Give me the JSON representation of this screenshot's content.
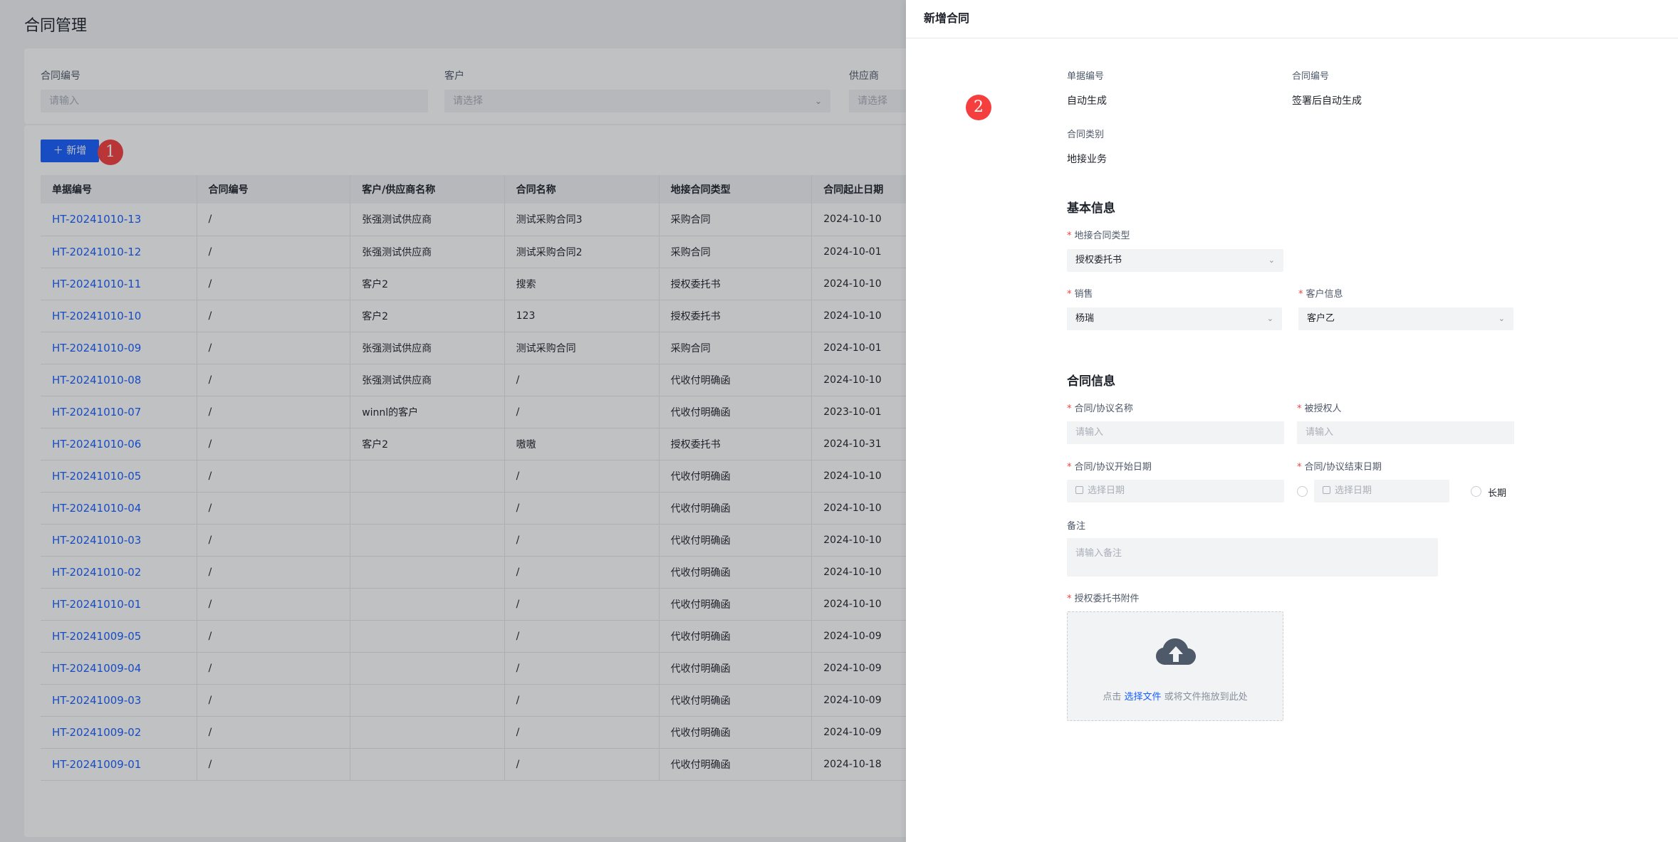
{
  "page": {
    "title": "合同管理",
    "filters": [
      {
        "label": "合同编号",
        "placeholder": "请输入"
      },
      {
        "label": "客户",
        "placeholder": "请选择"
      },
      {
        "label": "供应商",
        "placeholder": "请选择"
      }
    ],
    "add_button": "＋ 新增",
    "badge1": "1",
    "table": {
      "headers": [
        "单据编号",
        "合同编号",
        "客户/供应商名称",
        "合同名称",
        "地接合同类型",
        "合同起止日期"
      ],
      "rows": [
        [
          "HT-20241010-13",
          "/",
          "张强测试供应商",
          "测试采购合同3",
          "采购合同",
          "2024-10-10"
        ],
        [
          "HT-20241010-12",
          "/",
          "张强测试供应商",
          "测试采购合同2",
          "采购合同",
          "2024-10-01"
        ],
        [
          "HT-20241010-11",
          "/",
          "客户2",
          "搜索",
          "授权委托书",
          "2024-10-10"
        ],
        [
          "HT-20241010-10",
          "/",
          "客户2",
          "123",
          "授权委托书",
          "2024-10-10"
        ],
        [
          "HT-20241010-09",
          "/",
          "张强测试供应商",
          "测试采购合同",
          "采购合同",
          "2024-10-01"
        ],
        [
          "HT-20241010-08",
          "/",
          "张强测试供应商",
          "/",
          "代收付明确函",
          "2024-10-10"
        ],
        [
          "HT-20241010-07",
          "/",
          "winnl的客户",
          "/",
          "代收付明确函",
          "2023-10-01"
        ],
        [
          "HT-20241010-06",
          "/",
          "客户2",
          "嗷嗷",
          "授权委托书",
          "2024-10-31"
        ],
        [
          "HT-20241010-05",
          "/",
          "",
          "/",
          "代收付明确函",
          "2024-10-10"
        ],
        [
          "HT-20241010-04",
          "/",
          "",
          "/",
          "代收付明确函",
          "2024-10-10"
        ],
        [
          "HT-20241010-03",
          "/",
          "",
          "/",
          "代收付明确函",
          "2024-10-10"
        ],
        [
          "HT-20241010-02",
          "/",
          "",
          "/",
          "代收付明确函",
          "2024-10-10"
        ],
        [
          "HT-20241010-01",
          "/",
          "",
          "/",
          "代收付明确函",
          "2024-10-10"
        ],
        [
          "HT-20241009-05",
          "/",
          "",
          "/",
          "代收付明确函",
          "2024-10-09"
        ],
        [
          "HT-20241009-04",
          "/",
          "",
          "/",
          "代收付明确函",
          "2024-10-09"
        ],
        [
          "HT-20241009-03",
          "/",
          "",
          "/",
          "代收付明确函",
          "2024-10-09"
        ],
        [
          "HT-20241009-02",
          "/",
          "",
          "/",
          "代收付明确函",
          "2024-10-09"
        ],
        [
          "HT-20241009-01",
          "/",
          "",
          "/",
          "代收付明确函",
          "2024-10-18"
        ]
      ]
    }
  },
  "drawer": {
    "title": "新增合同",
    "badge2": "2",
    "doc_no_label": "单据编号",
    "doc_no_value": "自动生成",
    "contract_no_label": "合同编号",
    "contract_no_value": "签署后自动生成",
    "category_label": "合同类别",
    "category_value": "地接业务",
    "basic_section": "基本信息",
    "type_label": "地接合同类型",
    "type_value": "授权委托书",
    "sales_label": "销售",
    "sales_value": "杨瑞",
    "customer_label": "客户信息",
    "customer_value": "客户乙",
    "contract_section": "合同信息",
    "name_label": "合同/协议名称",
    "name_placeholder": "请输入",
    "grantee_label": "被授权人",
    "grantee_placeholder": "请输入",
    "start_label": "合同/协议开始日期",
    "start_placeholder": "选择日期",
    "end_label": "合同/协议结束日期",
    "end_placeholder": "选择日期",
    "long_term_label": "长期",
    "remark_label": "备注",
    "remark_placeholder": "请输入备注",
    "attachment_label": "授权委托书附件",
    "upload_prefix": "点击 ",
    "upload_link": "选择文件",
    "upload_suffix": " 或将文件拖放到此处",
    "required_mark": "*"
  },
  "colors": {
    "primary": "#165dff",
    "danger": "#f53f3f",
    "badge": "#f53f3f"
  },
  "icons": [
    "chevron-down-icon",
    "calendar-icon",
    "cloud-upload-icon",
    "plus-icon"
  ]
}
